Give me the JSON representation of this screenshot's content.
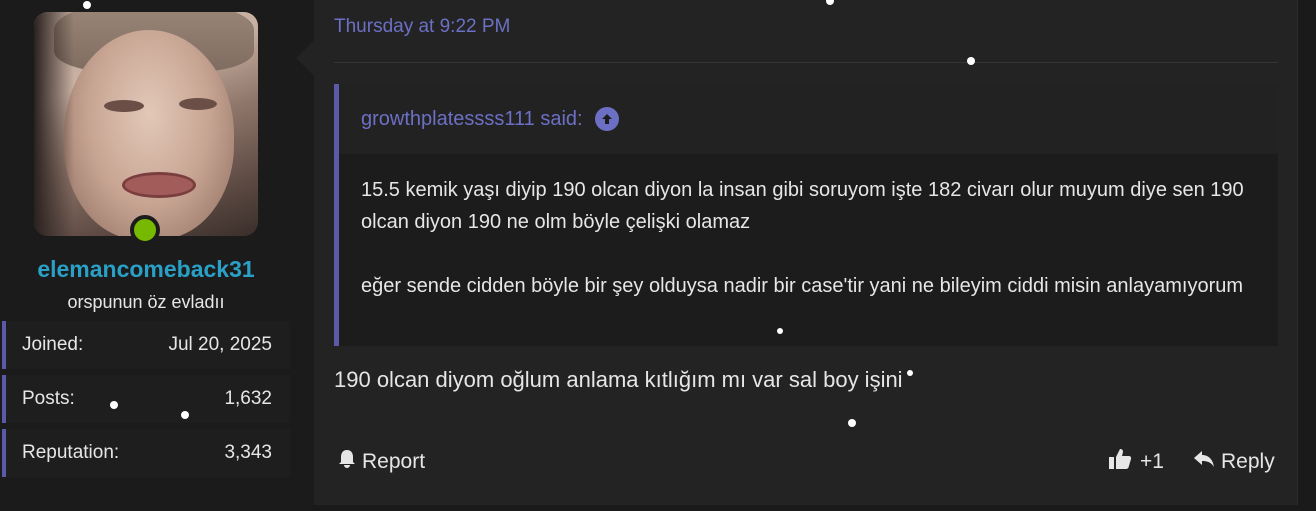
{
  "user": {
    "username": "elemancomeback31",
    "title": "orspunun öz evladıı",
    "stats": [
      {
        "label": "Joined:",
        "value": "Jul 20, 2025"
      },
      {
        "label": "Posts:",
        "value": "1,632"
      },
      {
        "label": "Reputation:",
        "value": "3,343"
      }
    ],
    "online": true
  },
  "post": {
    "timestamp": "Thursday at 9:22 PM",
    "quote": {
      "author_line": "growthplatessss111 said:",
      "paragraphs": [
        "15.5 kemik yaşı diyip 190 olcan diyon la insan gibi soruyom işte 182 civarı olur muyum diye sen 190 olcan diyon 190 ne olm böyle çelişki olamaz",
        "eğer sende cidden böyle bir şey olduysa nadir bir case'tir yani ne bileyim ciddi misin anlayamıyorum"
      ]
    },
    "message": "190 olcan diyom oğlum anlama kıtlığım mı var sal boy işini",
    "actions": {
      "report": "Report",
      "like_count": "+1",
      "reply": "Reply"
    }
  },
  "colors": {
    "accent": "#6c70c4",
    "username": "#2aa0c6",
    "online": "#77b800"
  }
}
